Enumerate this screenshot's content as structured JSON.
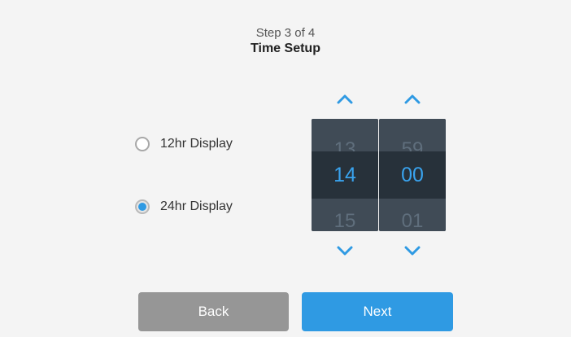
{
  "header": {
    "step": "Step 3 of 4",
    "title": "Time Setup"
  },
  "display_mode": {
    "options": [
      {
        "label": "12hr Display",
        "selected": false
      },
      {
        "label": "24hr Display",
        "selected": true
      }
    ]
  },
  "time_picker": {
    "hours": {
      "previous": "13",
      "current": "14",
      "next": "15"
    },
    "minutes": {
      "previous": "59",
      "current": "00",
      "next": "01"
    },
    "up_icon": "chevron-up-icon",
    "down_icon": "chevron-down-icon"
  },
  "buttons": {
    "back_label": "Back",
    "next_label": "Next"
  },
  "colors": {
    "accent": "#2f9ae3",
    "selected_value": "#39a3ee",
    "picker_bg": "#3a444f",
    "back_button": "#969696"
  }
}
